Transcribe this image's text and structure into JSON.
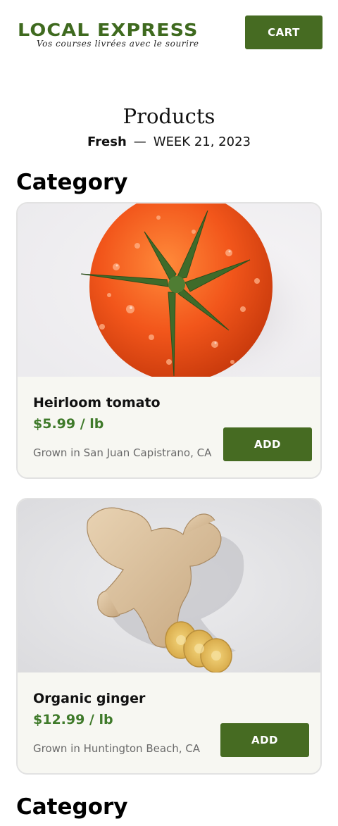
{
  "header": {
    "logo_title": "LOCAL EXPRESS",
    "logo_tagline": "Vos courses livrées avec le sourire",
    "cart_label": "CART"
  },
  "page": {
    "title": "Products",
    "subtitle_tag": "Fresh",
    "subtitle_sep": "—",
    "subtitle_week": "WEEK 21, 2023"
  },
  "sections": [
    {
      "heading": "Category",
      "products": [
        {
          "name": "Heirloom tomato",
          "price": "$5.99 / lb",
          "origin": "Grown in San Juan Capistrano, CA",
          "add_label": "ADD",
          "image": "tomato-image"
        },
        {
          "name": "Organic ginger",
          "price": "$12.99 / lb",
          "origin": "Grown in Huntington Beach, CA",
          "add_label": "ADD",
          "image": "ginger-image"
        }
      ]
    },
    {
      "heading": "Category",
      "products": []
    }
  ],
  "colors": {
    "brand_green": "#466b22",
    "price_green": "#3f7a2a",
    "card_bg": "#f7f7f2"
  }
}
